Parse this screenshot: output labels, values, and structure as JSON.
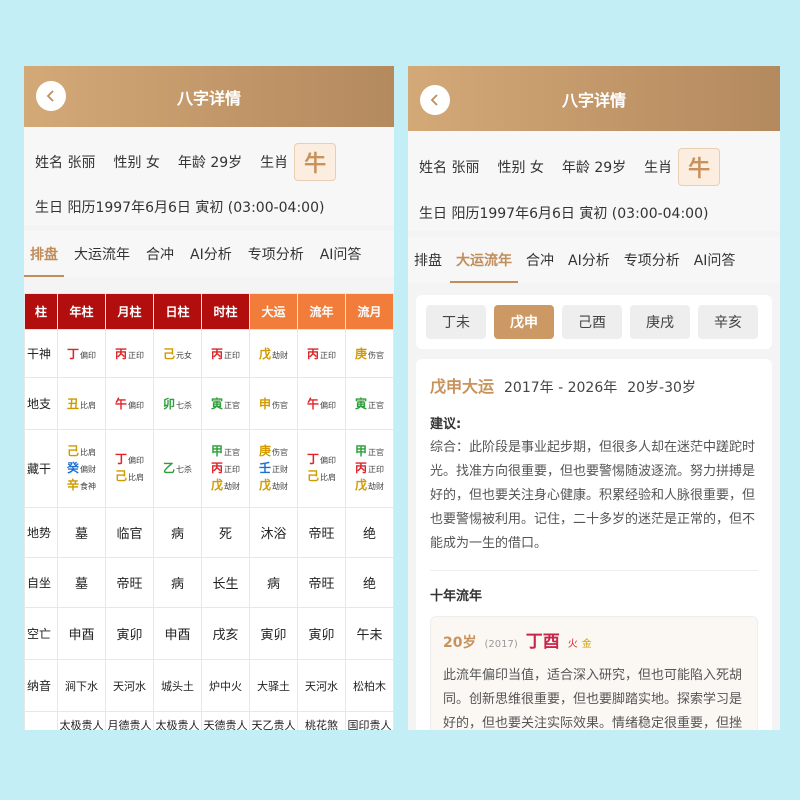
{
  "header": {
    "title": "八字详情"
  },
  "profile": {
    "name": "姓名 张丽",
    "gender": "性别 女",
    "age": "年龄 29岁",
    "zodiac_label": "生肖",
    "zodiac": "牛",
    "birth": "生日 阳历1997年6月6日 寅初 (03:00-04:00)"
  },
  "tabs": [
    "排盘",
    "大运流年",
    "合冲",
    "AI分析",
    "专项分析",
    "AI问答"
  ],
  "chart": {
    "headers": [
      "柱",
      "年柱",
      "月柱",
      "日柱",
      "时柱",
      "大运",
      "流年",
      "流月"
    ],
    "shishen": {
      "label": "干神",
      "cells": [
        [
          "丁",
          "偏印"
        ],
        [
          "丙",
          "正印"
        ],
        [
          "己",
          "元女"
        ],
        [
          "丙",
          "正印"
        ],
        [
          "戊",
          "劫财"
        ],
        [
          "丙",
          "正印"
        ],
        [
          "庚",
          "伤官"
        ]
      ]
    },
    "dizhi": {
      "label": "地支",
      "cells": [
        [
          "丑",
          "比肩"
        ],
        [
          "午",
          "偏印"
        ],
        [
          "卯",
          "七杀"
        ],
        [
          "寅",
          "正官"
        ],
        [
          "申",
          "伤官"
        ],
        [
          "午",
          "偏印"
        ],
        [
          "寅",
          "正官"
        ]
      ]
    },
    "canggan": {
      "label": "藏干",
      "cells": [
        [
          [
            "己",
            "比肩"
          ],
          [
            "癸",
            "偏财"
          ],
          [
            "辛",
            "食神"
          ]
        ],
        [
          [
            "丁",
            "偏印"
          ],
          [
            "己",
            "比肩"
          ]
        ],
        [
          [
            "乙",
            "七杀"
          ]
        ],
        [
          [
            "甲",
            "正官"
          ],
          [
            "丙",
            "正印"
          ],
          [
            "戊",
            "劫财"
          ]
        ],
        [
          [
            "庚",
            "伤官"
          ],
          [
            "壬",
            "正财"
          ],
          [
            "戊",
            "劫财"
          ]
        ],
        [
          [
            "丁",
            "偏印"
          ],
          [
            "己",
            "比肩"
          ]
        ],
        [
          [
            "甲",
            "正官"
          ],
          [
            "丙",
            "正印"
          ],
          [
            "戊",
            "劫财"
          ]
        ]
      ]
    },
    "dishi": {
      "label": "地势",
      "cells": [
        "墓",
        "临官",
        "病",
        "死",
        "沐浴",
        "帝旺",
        "绝"
      ]
    },
    "zizuo": {
      "label": "自坐",
      "cells": [
        "墓",
        "帝旺",
        "病",
        "长生",
        "病",
        "帝旺",
        "绝"
      ]
    },
    "kongwang": {
      "label": "空亡",
      "cells": [
        "申酉",
        "寅卯",
        "申酉",
        "戌亥",
        "寅卯",
        "寅卯",
        "午未"
      ]
    },
    "nayin": {
      "label": "纳音",
      "cells": [
        "涧下水",
        "天河水",
        "城头土",
        "炉中火",
        "大驿土",
        "天河水",
        "松柏木"
      ]
    },
    "shensha": {
      "cells": [
        "太极贵人",
        "月德贵人",
        "太极贵人",
        "天德贵人",
        "天乙贵人",
        "桃花煞",
        "国印贵人"
      ]
    }
  },
  "colors": {
    "丁": "#e0242a",
    "丙": "#e0242a",
    "午": "#e0242a",
    "己": "#d09a00",
    "戊": "#d09a00",
    "丑": "#d09a00",
    "庚": "#d09a00",
    "申": "#d09a00",
    "辛": "#d09a00",
    "卯": "#2e9e3a",
    "寅": "#2e9e3a",
    "甲": "#2e9e3a",
    "乙": "#2e9e3a",
    "癸": "#1f6fd1",
    "壬": "#1f6fd1"
  },
  "dayun": {
    "years": [
      "丁未",
      "戊申",
      "己酉",
      "庚戌",
      "辛亥"
    ],
    "active_name": "戊申大运",
    "active_range": "2017年 - 2026年",
    "active_age": "20岁-30岁",
    "advice_label": "建议:",
    "advice": "综合：此阶段是事业起步期，但很多人却在迷茫中蹉跎时光。找准方向很重要，但也要警惕随波逐流。努力拼搏是好的，但也要关注身心健康。积累经验和人脉很重要，但也要警惕被利用。记住，二十多岁的迷茫是正常的，但不能成为一生的借口。",
    "liunian_label": "十年流年",
    "liunian": {
      "age": "20岁",
      "year": "(2017)",
      "gz": "丁酉",
      "wx1": "火",
      "wx2": "金",
      "text": "此流年偏印当值，适合深入研究，但也可能陷入死胡同。创新思维很重要，但也要脚踏实地。探索学习是好的，但也要关注实际效果。情绪稳定很重要，但挫"
    }
  }
}
